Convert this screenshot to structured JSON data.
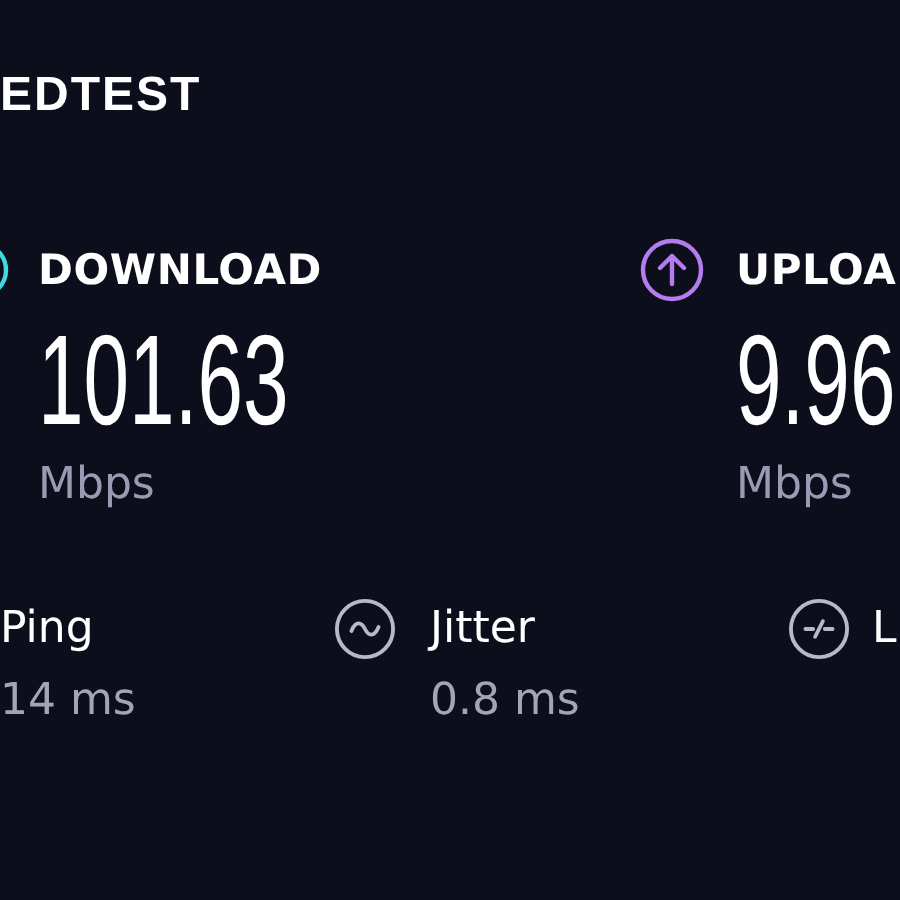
{
  "logo": {
    "text": "EDTEST"
  },
  "metrics": [
    {
      "kind": "download",
      "label": "DOWNLOAD",
      "value": "101.63",
      "unit": "Mbps",
      "color": "#3fd9e0"
    },
    {
      "kind": "upload",
      "label": "UPLOA",
      "value": "9.96",
      "unit": "Mbps",
      "color": "#b47cf0"
    }
  ],
  "stats": [
    {
      "kind": "ping",
      "label": "Ping",
      "value": "14 ms"
    },
    {
      "kind": "jitter",
      "label": "Jitter",
      "value": "0.8 ms"
    },
    {
      "kind": "latency",
      "label": "L"
    }
  ]
}
